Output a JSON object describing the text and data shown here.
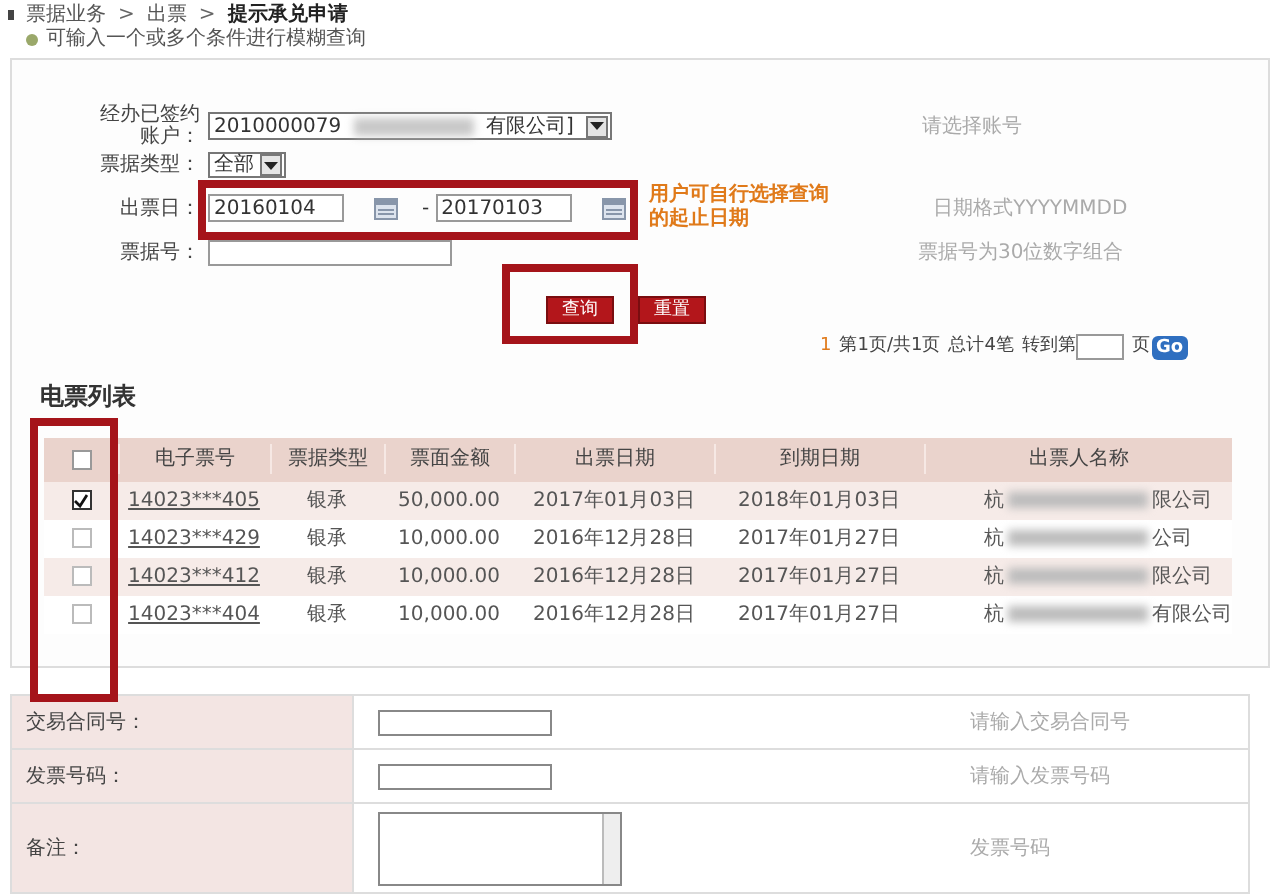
{
  "breadcrumb": [
    {
      "label": "票据业务",
      "current": false
    },
    {
      "label": "出票",
      "current": false
    },
    {
      "label": "提示承兑申请",
      "current": true
    }
  ],
  "breadcrumb_separator": ">",
  "hint": "可输入一个或多个条件进行模糊查询",
  "query_form": {
    "account": {
      "label": "经办已签约账户：",
      "value_start": "2010000079",
      "value_end": "有限公司]",
      "help": "请选择账号"
    },
    "bill_type": {
      "label": "票据类型：",
      "value": "全部"
    },
    "issue_date": {
      "label": "出票日：",
      "from": "20160104",
      "range_dash": "-",
      "to": "20170103",
      "annotation": "用户可自行选择查询的起止日期",
      "help": "日期格式YYYYMMDD"
    },
    "bill_no": {
      "label": "票据号：",
      "help": "票据号为30位数字组合"
    },
    "buttons": [
      "查询",
      "重置"
    ]
  },
  "pager": {
    "current": "1",
    "info": "第1页/共1页",
    "total": "总计4笔",
    "goto": "转到第",
    "page_unit": "页",
    "go": "Go"
  },
  "list": {
    "title": "电票列表",
    "select_all_checked": false,
    "columns": [
      "电子票号",
      "票据类型",
      "票面金额",
      "出票日期",
      "到期日期",
      "出票人名称"
    ],
    "rows": [
      {
        "checked": true,
        "no": "14023***405",
        "type": "银承",
        "amount": "50,000.00",
        "issue": "2017年01月03日",
        "due": "2018年01月03日",
        "drawer_start": "杭",
        "drawer_end": "限公司"
      },
      {
        "checked": false,
        "no": "14023***429",
        "type": "银承",
        "amount": "10,000.00",
        "issue": "2016年12月28日",
        "due": "2017年01月27日",
        "drawer_start": "杭",
        "drawer_end": "公司"
      },
      {
        "checked": false,
        "no": "14023***412",
        "type": "银承",
        "amount": "10,000.00",
        "issue": "2016年12月28日",
        "due": "2017年01月27日",
        "drawer_start": "杭",
        "drawer_end": "限公司"
      },
      {
        "checked": false,
        "no": "14023***404",
        "type": "银承",
        "amount": "10,000.00",
        "issue": "2016年12月28日",
        "due": "2017年01月27日",
        "drawer_start": "杭",
        "drawer_end": "有限公司"
      }
    ]
  },
  "extra_form": [
    {
      "kind": "input",
      "label": "交易合同号：",
      "help": "请输入交易合同号"
    },
    {
      "kind": "input",
      "label": "发票号码：",
      "help": "请输入发票号码"
    },
    {
      "kind": "textarea",
      "label": "备注：",
      "help": "发票号码"
    }
  ]
}
